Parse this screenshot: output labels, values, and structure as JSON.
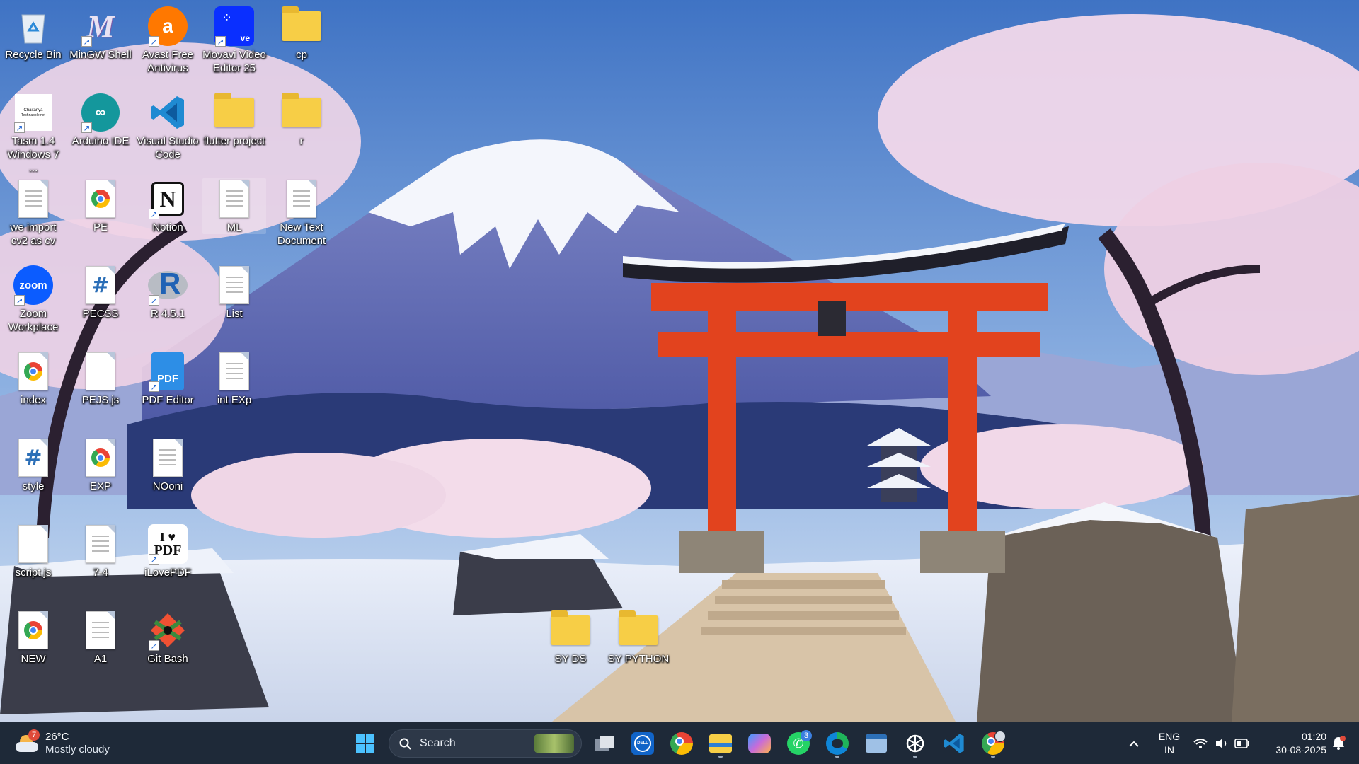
{
  "desktop": {
    "icons": [
      {
        "label": "Recycle Bin"
      },
      {
        "label": "MinGW Shell"
      },
      {
        "label": "Avast Free Antivirus"
      },
      {
        "label": "Movavi Video Editor 25"
      },
      {
        "label": "cp"
      },
      {
        "label": "Tasm 1.4 Windows 7 ..."
      },
      {
        "label": "Arduino IDE"
      },
      {
        "label": "Visual Studio Code"
      },
      {
        "label": "flutter project"
      },
      {
        "label": "r"
      },
      {
        "label": "we import cv2 as cv"
      },
      {
        "label": "PE"
      },
      {
        "label": "Notion"
      },
      {
        "label": "ML"
      },
      {
        "label": "New Text Document"
      },
      {
        "label": "Zoom Workplace"
      },
      {
        "label": "PECSS"
      },
      {
        "label": "R 4.5.1"
      },
      {
        "label": "List"
      },
      {
        "label": "index"
      },
      {
        "label": "PEJS.js"
      },
      {
        "label": "PDF Editor"
      },
      {
        "label": "int EXp"
      },
      {
        "label": "style"
      },
      {
        "label": "EXP"
      },
      {
        "label": "NOoni"
      },
      {
        "label": "script.js"
      },
      {
        "label": "7-4"
      },
      {
        "label": "iLovePDF"
      },
      {
        "label": "NEW"
      },
      {
        "label": "A1"
      },
      {
        "label": "Git Bash"
      },
      {
        "label": "SY DS"
      },
      {
        "label": "SY PYTHON"
      }
    ],
    "icon_glyphs": {
      "zoom": "zoom",
      "movavi": "ve",
      "ilovepdf_top": "I ♥",
      "ilovepdf_bottom": "PDF",
      "pdf_editor": "PDF",
      "r": "R",
      "notion": "N",
      "hash": "#",
      "mingw": "M",
      "tasm_line1": "Chaitanya",
      "tasm_line2": "Technapple.net"
    }
  },
  "taskbar": {
    "weather": {
      "temp": "26°C",
      "condition": "Mostly cloudy",
      "alert_count": "7"
    },
    "search": {
      "placeholder": "Search"
    },
    "apps": [
      {
        "name": "start"
      },
      {
        "name": "task-view"
      },
      {
        "name": "dell"
      },
      {
        "name": "chrome"
      },
      {
        "name": "file-explorer"
      },
      {
        "name": "copilot"
      },
      {
        "name": "whatsapp",
        "badge": "3"
      },
      {
        "name": "edge"
      },
      {
        "name": "app"
      },
      {
        "name": "chatgpt"
      },
      {
        "name": "vscode"
      },
      {
        "name": "chrome-profile"
      }
    ],
    "dell_label": "DELL",
    "tray": {
      "lang_line1": "ENG",
      "lang_line2": "IN",
      "time": "01:20",
      "date": "30-08-2025"
    }
  },
  "colors": {
    "taskbar_bg": "#1e2938",
    "accent": "#3b7fe0",
    "torii_red": "#e2431e"
  }
}
